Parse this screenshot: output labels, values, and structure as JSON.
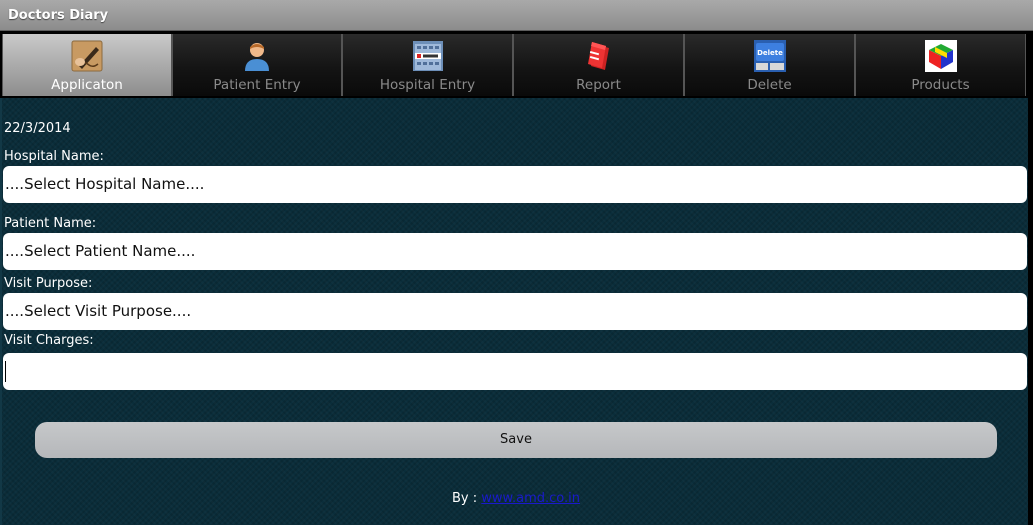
{
  "window": {
    "title": "Doctors Diary"
  },
  "tabs": [
    {
      "label": "Applicaton",
      "icon": "pen-writing-icon",
      "selected": true
    },
    {
      "label": "Patient Entry",
      "icon": "person-icon",
      "selected": false
    },
    {
      "label": "Hospital Entry",
      "icon": "hospital-building-icon",
      "selected": false
    },
    {
      "label": "Report",
      "icon": "report-books-icon",
      "selected": false
    },
    {
      "label": "Delete",
      "icon": "delete-key-icon",
      "selected": false
    },
    {
      "label": "Products",
      "icon": "products-cube-icon",
      "selected": false
    }
  ],
  "form": {
    "date": "22/3/2014",
    "hospital": {
      "label": "Hospital Name:",
      "value": "....Select Hospital Name...."
    },
    "patient": {
      "label": "Patient Name:",
      "value": "....Select Patient Name...."
    },
    "purpose": {
      "label": "Visit Purpose:",
      "value": "....Select Visit Purpose...."
    },
    "charges": {
      "label": "Visit Charges:",
      "value": ""
    },
    "save_label": "Save"
  },
  "footer": {
    "prefix": "By : ",
    "link_text": "www.amd.co.in"
  },
  "colors": {
    "background": "#0a2d3a",
    "link": "#1a1acc",
    "save_button": "#bfc1c4"
  }
}
